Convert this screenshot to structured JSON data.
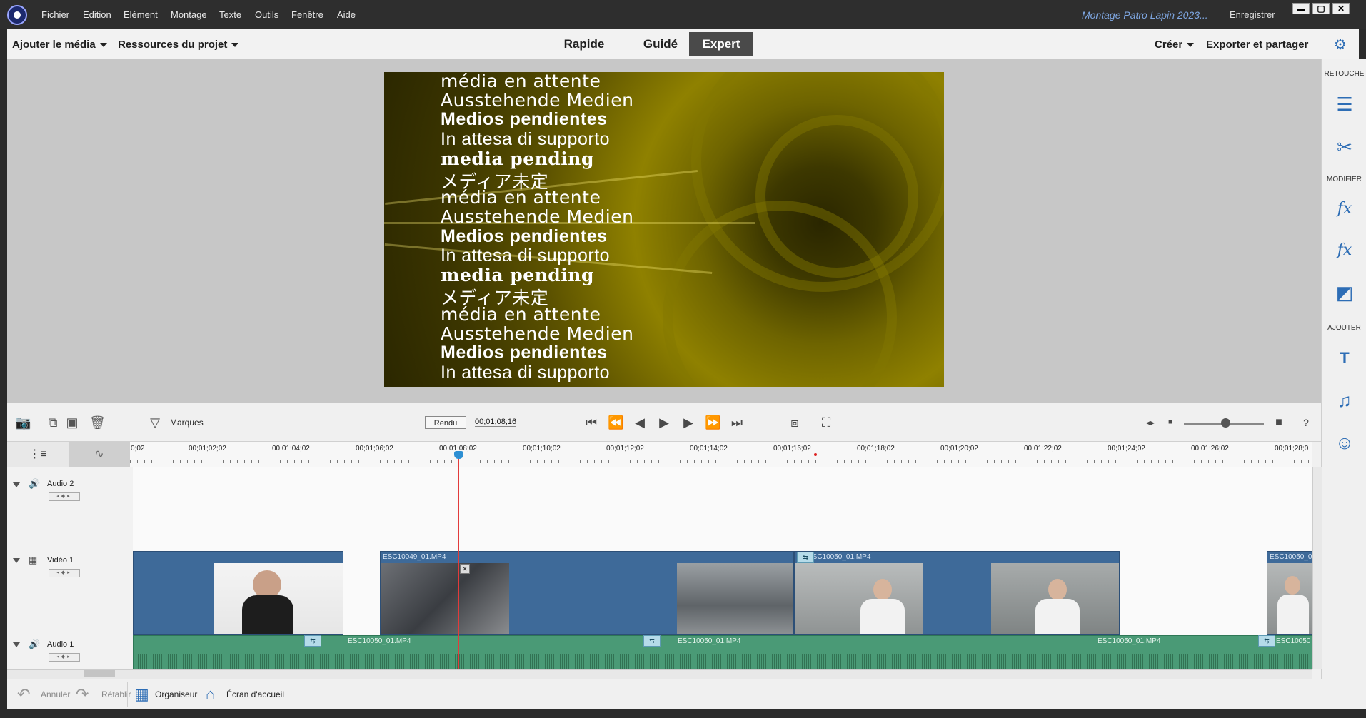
{
  "menubar": {
    "items": [
      "Fichier",
      "Edition",
      "Elément",
      "Montage",
      "Texte",
      "Outils",
      "Fenêtre",
      "Aide"
    ],
    "project_name": "Montage Patro Lapin 2023...",
    "save_label": "Enregistrer",
    "window_buttons": [
      "▬",
      "▢",
      "✕"
    ]
  },
  "toolbar": {
    "add_media": "Ajouter le média",
    "project_assets": "Ressources du projet",
    "modes": [
      "Rapide",
      "Guidé",
      "Expert"
    ],
    "active_mode": "Expert",
    "create": "Créer",
    "export_share": "Exporter et partager"
  },
  "preview": {
    "lines": [
      "média en attente",
      "Ausstehende Medien",
      "Medios pendientes",
      "In attesa di supporto",
      "media pending",
      "メディア未定",
      "média en attente",
      "Ausstehende Medien",
      "Medios pendientes",
      "In attesa di supporto",
      "media pending",
      "メディア未定",
      "média en attente",
      "Ausstehende Medien",
      "Medios pendientes",
      "In attesa di supporto"
    ]
  },
  "right_panel": {
    "retouch_label": "RETOUCHE",
    "modify_label": "MODIFIER",
    "add_label": "AJOUTER"
  },
  "timeline": {
    "markers_label": "Marques",
    "render_label": "Rendu",
    "timecode": "00;01;08;16",
    "ruler_labels": [
      "0;02",
      "00;01;02;02",
      "00;01;04;02",
      "00;01;06;02",
      "00;01;08;02",
      "00;01;10;02",
      "00;01;12;02",
      "00;01;14;02",
      "00;01;16;02",
      "00;01;18;02",
      "00;01;20;02",
      "00;01;22;02",
      "00;01;24;02",
      "00;01;26;02",
      "00;01;28;0"
    ],
    "tracks": {
      "audio2": "Audio 2",
      "video1": "Vidéo 1",
      "audio1": "Audio 1"
    },
    "video_clips": [
      "ESC10049_01.MP4",
      "ESC10050_01.MP4",
      "ESC10050_0"
    ],
    "audio_clips": [
      "ESC10050_01.MP4",
      "ESC10050_01.MP4",
      "ESC10050_01.MP4",
      "ESC10050"
    ]
  },
  "bottombar": {
    "undo": "Annuler",
    "redo": "Rétablir",
    "organizer": "Organiseur",
    "home": "Écran d'accueil"
  },
  "colors": {
    "accent": "#2d6db5",
    "video_clip": "#3e6a99",
    "audio_clip": "#4a9a76",
    "playhead": "#e23b3b"
  }
}
